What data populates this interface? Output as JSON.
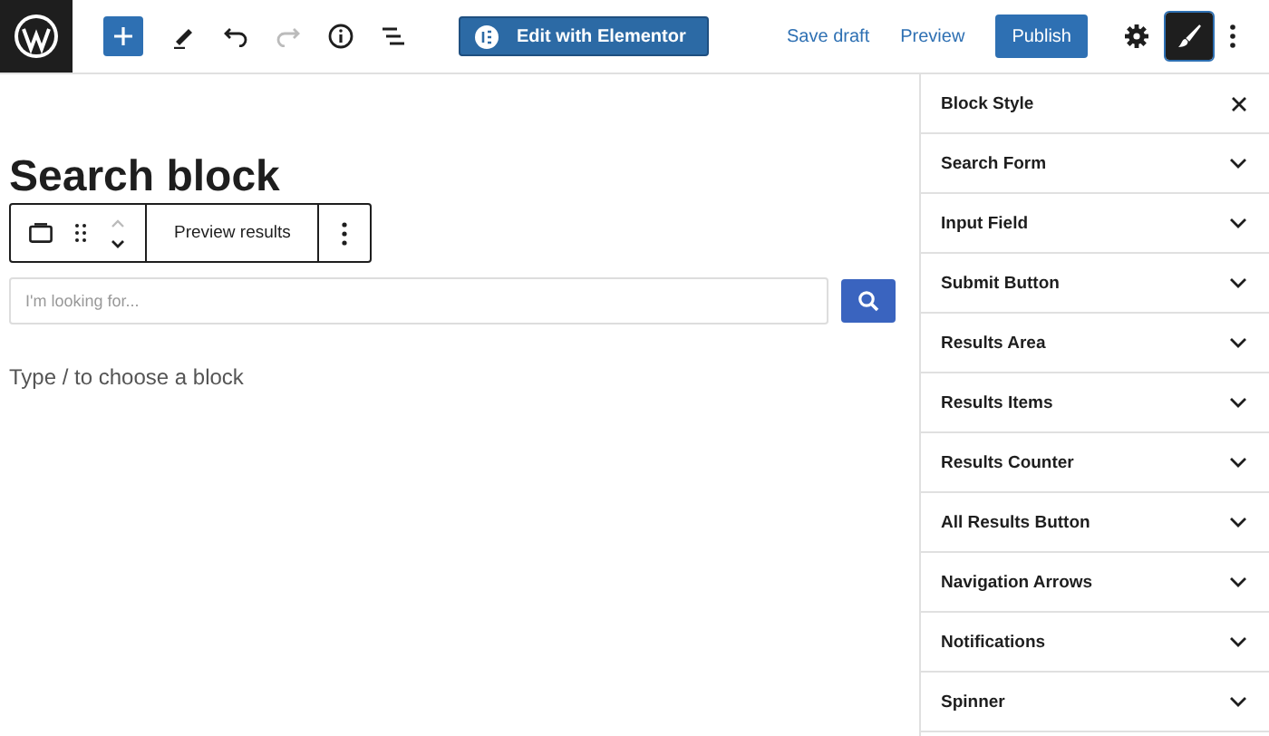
{
  "topbar": {
    "edit_button": "Edit with Elementor",
    "save_draft": "Save draft",
    "preview": "Preview",
    "publish": "Publish",
    "panel_toggles": [
      {
        "kind": "settings",
        "selected": false
      },
      {
        "kind": "style",
        "selected": true
      }
    ]
  },
  "editor": {
    "heading": "Search block",
    "toolbar_button": "Preview results",
    "search": {
      "placeholder": "I'm looking for..."
    },
    "appender": "Type / to choose a block"
  },
  "sidebar": {
    "title": "Block Style",
    "sections": [
      {
        "label": "Search Form",
        "expanded": false
      },
      {
        "label": "Input Field",
        "expanded": false
      },
      {
        "label": "Submit Button",
        "expanded": false
      },
      {
        "label": "Results Area",
        "expanded": false
      },
      {
        "label": "Results Items",
        "expanded": false
      },
      {
        "label": "Results Counter",
        "expanded": false
      },
      {
        "label": "All Results Button",
        "expanded": false
      },
      {
        "label": "Navigation Arrows",
        "expanded": false
      },
      {
        "label": "Notifications",
        "expanded": false
      },
      {
        "label": "Spinner",
        "expanded": false
      }
    ]
  }
}
